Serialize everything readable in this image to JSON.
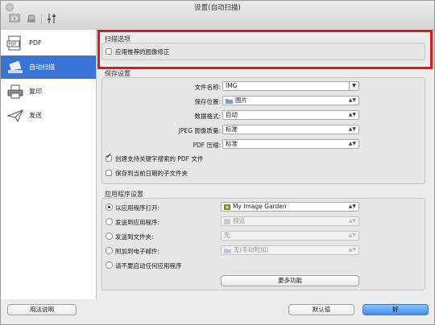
{
  "window": {
    "title": "设置(自动扫描)"
  },
  "sidebar": {
    "items": [
      {
        "label": "PDF"
      },
      {
        "label": "自动扫描"
      },
      {
        "label": "复印"
      },
      {
        "label": "发送"
      }
    ]
  },
  "scan_options": {
    "group_label": "扫描选项",
    "apply_correction": {
      "label": "应用推荐的图像修正",
      "checked": false
    }
  },
  "save_settings": {
    "group_label": "保存设置",
    "file_name": {
      "label": "文件名称:",
      "value": "IMG"
    },
    "save_location": {
      "label": "保存位置:",
      "value": "图片"
    },
    "data_format": {
      "label": "数据格式:",
      "value": "自动"
    },
    "jpeg_quality": {
      "label": "JPEG 图像质量:",
      "value": "标准"
    },
    "pdf_compression": {
      "label": "PDF 压缩:",
      "value": "标准"
    },
    "create_pdf_keyword": {
      "label": "创建支持关键字搜索的 PDF 文件",
      "checked": true
    },
    "save_subfolder": {
      "label": "保存到当前日期的子文件夹",
      "checked": false
    }
  },
  "app_settings": {
    "group_label": "应用程序设置",
    "open_with_app": {
      "label": "以应用程序打开:",
      "value": "My Image Garden",
      "selected": true
    },
    "send_to_app": {
      "label": "发送到应用程序:",
      "value": "预览"
    },
    "send_to_folder": {
      "label": "发送到文件夹:",
      "value": "无"
    },
    "attach_email": {
      "label": "附加到电子邮件:",
      "value": "无(手动附加)"
    },
    "no_app": {
      "label": "请不要启动任何应用程序"
    },
    "more_functions": "更多功能"
  },
  "footer": {
    "instructions": "用法说明",
    "defaults": "默认值",
    "ok": "好"
  },
  "colors": {
    "accent": "#3875d7",
    "highlight": "#e8141b"
  }
}
